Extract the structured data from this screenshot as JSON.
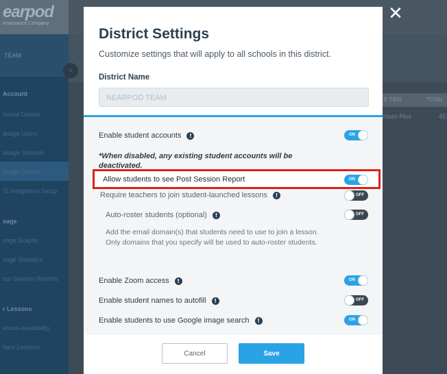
{
  "background": {
    "logo": {
      "brand": "earpod",
      "tagline": "enaissance Company"
    },
    "team_label": "TEAM",
    "nav": [
      {
        "label": "Account",
        "head": true
      },
      {
        "label": "rsonal Details"
      },
      {
        "label": "anage Users"
      },
      {
        "label": "anage Schools"
      },
      {
        "label": "anage District",
        "active": true
      },
      {
        "label": "IS Integration Setup"
      },
      {
        "label": "sage",
        "head": true
      },
      {
        "label": "sage Graphs"
      },
      {
        "label": "sage Statistics"
      },
      {
        "label": "ost-Session Reports"
      },
      {
        "label": "r Lessons",
        "head": true
      },
      {
        "label": "esson Availability"
      },
      {
        "label": "hare Lessons"
      }
    ],
    "table_headers": [
      "E TIER",
      "TOTAL"
    ],
    "table_cells": [
      "mium Plus",
      "45"
    ]
  },
  "modal": {
    "title": "District Settings",
    "subtitle": "Customize settings that will apply to all schools in this district.",
    "district_name_label": "District Name",
    "district_name_value": "NEARPOD TEAM",
    "settings": {
      "student_accounts": {
        "label": "Enable student accounts",
        "state": "ON"
      },
      "student_accounts_note": "*When disabled, any existing student accounts will be deactivated.",
      "post_session_report": {
        "label": "Allow students to see Post Session Report",
        "state": "ON"
      },
      "require_teachers": {
        "label": "Require teachers to join student-launched lessons",
        "state": "OFF"
      },
      "auto_roster": {
        "label": "Auto-roster students (optional)",
        "state": "OFF"
      },
      "auto_roster_help": "Add the email domain(s) that students need to use to join a lesson. Only domains that you specify will be used to auto-roster students.",
      "zoom_access": {
        "label": "Enable Zoom access",
        "state": "ON"
      },
      "names_autofill": {
        "label": "Enable student names to autofill",
        "state": "OFF"
      },
      "google_image_search": {
        "label": "Enable students to use Google image search",
        "state": "ON"
      }
    },
    "info_glyph": "!",
    "cancel_label": "Cancel",
    "save_label": "Save"
  },
  "close_glyph": "✕",
  "colors": {
    "accent": "#2aa3e6",
    "highlight_border": "#e0201a",
    "toggle_off": "#3c4752",
    "title": "#2b3f52"
  }
}
